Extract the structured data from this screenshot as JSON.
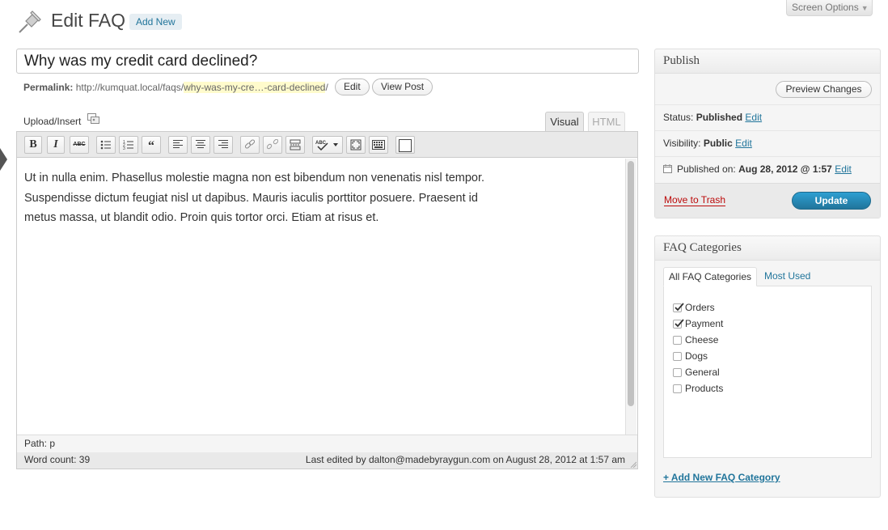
{
  "header": {
    "title": "Edit FAQ",
    "add_new": "Add New",
    "screen_options": "Screen Options"
  },
  "post": {
    "title": "Why was my credit card declined?",
    "permalink_label": "Permalink:",
    "permalink_base": "http://kumquat.local/faqs/",
    "permalink_slug": "why-was-my-cre…-card-declined",
    "permalink_trail": "/",
    "edit_label": "Edit",
    "view_post_label": "View Post"
  },
  "editor": {
    "upload_insert": "Upload/Insert",
    "tab_visual": "Visual",
    "tab_html": "HTML",
    "toolbar": {
      "bold": "B",
      "italic": "I",
      "strikethrough": "ABC",
      "blockquote": "“"
    },
    "content_lines": [
      "Ut in nulla enim. Phasellus molestie magna non est bibendum non venenatis nisl tempor.",
      "Suspendisse dictum feugiat nisl ut dapibus. Mauris iaculis porttitor posuere. Praesent id",
      "metus massa, ut blandit odio. Proin quis tortor orci. Etiam at risus et."
    ],
    "path_label": "Path:",
    "path_value": "p",
    "word_count": "Word count: 39",
    "last_edited": "Last edited by dalton@madebyraygun.com on August 28, 2012 at 1:57 am"
  },
  "publish": {
    "heading": "Publish",
    "preview_changes": "Preview Changes",
    "status_label": "Status:",
    "status_value": "Published",
    "visibility_label": "Visibility:",
    "visibility_value": "Public",
    "published_on_label": "Published on:",
    "published_on_value": "Aug 28, 2012 @ 1:57",
    "edit_link": "Edit",
    "move_to_trash": "Move to Trash",
    "update": "Update"
  },
  "categories": {
    "heading": "FAQ Categories",
    "tab_all": "All FAQ Categories",
    "tab_most_used": "Most Used",
    "items": [
      {
        "label": "Orders",
        "checked": true
      },
      {
        "label": "Payment",
        "checked": true
      },
      {
        "label": "Cheese",
        "checked": false
      },
      {
        "label": "Dogs",
        "checked": false
      },
      {
        "label": "General",
        "checked": false
      },
      {
        "label": "Products",
        "checked": false
      }
    ],
    "add_new": "+ Add New FAQ Category"
  },
  "colors": {
    "link": "#21759b",
    "trash": "#bc0b0b",
    "update_button": "#2e9fd2",
    "slug_highlight": "#fffbcc"
  }
}
